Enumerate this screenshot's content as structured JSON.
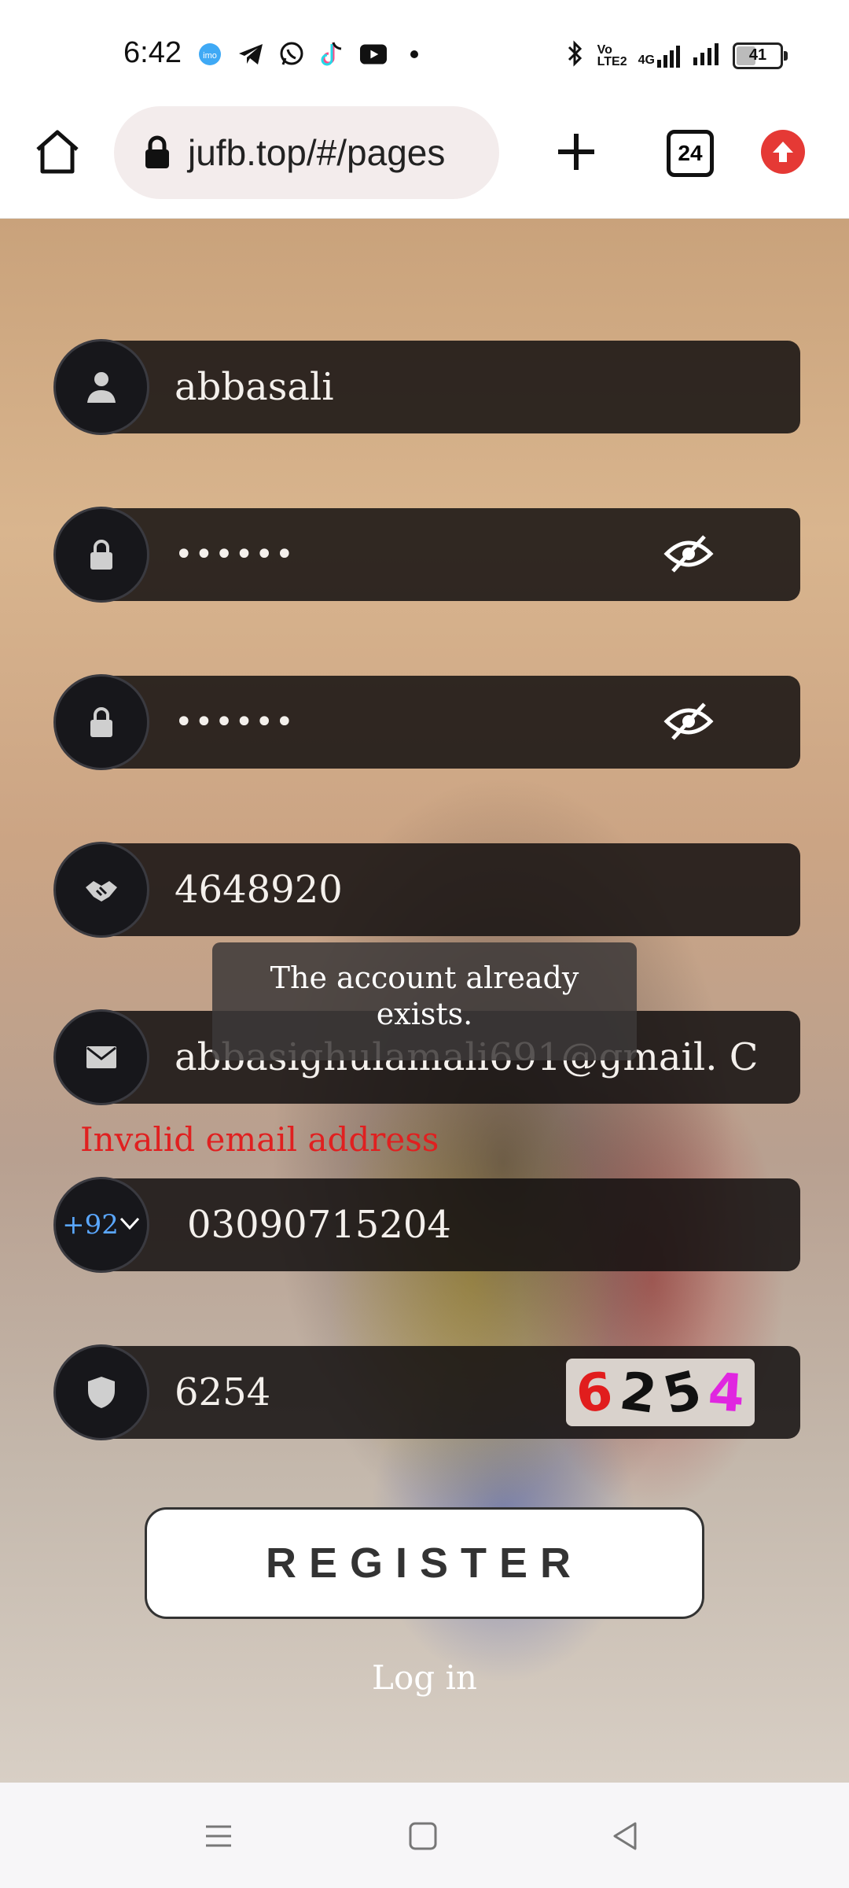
{
  "status_bar": {
    "time": "6:42",
    "battery": "41",
    "network": "4G",
    "volte": "Vo LTE2"
  },
  "browser": {
    "url": "jufb.top/#/pages",
    "tab_count": "24"
  },
  "form": {
    "username": "abbasali",
    "password": "••••••",
    "confirm_password": "••••••",
    "invite_code": "4648920",
    "email": "abbasighulamali691@gmail. C",
    "email_error": "Invalid email address",
    "country_code": "+92",
    "phone": "03090715204",
    "captcha_input": "6254",
    "captcha_image": {
      "digits": [
        "6",
        "2",
        "5",
        "4"
      ],
      "colors": [
        "#e11d1d",
        "#111111",
        "#111111",
        "#e026e0"
      ]
    },
    "register_label": "REGISTER",
    "login_label": "Log in"
  },
  "toast": {
    "message": "The account already exists."
  }
}
